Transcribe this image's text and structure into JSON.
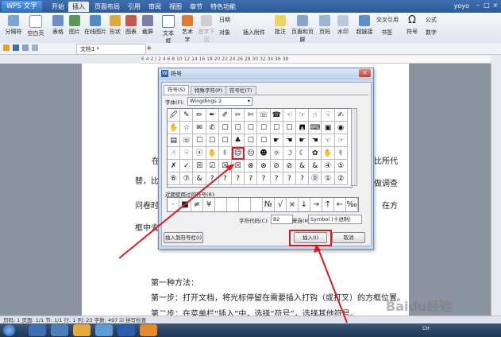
{
  "app": {
    "wps_button": "WPS 文字",
    "user": "yoyo"
  },
  "menu_tabs": [
    "开始",
    "插入",
    "页面布局",
    "引用",
    "审阅",
    "视图",
    "章节",
    "特色功能"
  ],
  "active_tab": "插入",
  "ribbon": {
    "page_break": "分隔符",
    "blank_page": "空白页",
    "table": "表格",
    "picture": "图片",
    "online_picture": "在线图片",
    "shapes": "形状",
    "chart": "图表",
    "screenshot": "截屏",
    "textbox": "文本框",
    "wordart": "艺术字",
    "down_drop": "首字下沉",
    "date": "日期",
    "object": "对象",
    "insert_attachment": "插入附件",
    "comment": "批注",
    "header_footer": "页眉和页脚",
    "page_number": "页码",
    "watermark": "水印",
    "hyperlink": "超链接",
    "bookmark": "书签",
    "cross_ref": "交叉引用",
    "formula": "公式",
    "symbol": "符号",
    "number": "数字"
  },
  "document_tab": "文档1 *",
  "ruler_text": "6 4 2 | 2 4 6 8 10 12 14 16 18 20 22 24 26 28 30 32 34 36 38",
  "doc_lines": [
    "在",
    "替，比",
    "问卷时",
    "框中去",
    "比所代",
    "做调查",
    "在方",
    "第一种方法：",
    "第一步：打开文档，将光标停留在需要插入打钩（或打叉）的方框位置。",
    "第二步：在菜单栏“插入”中，选择“符号”，选择其他符号。"
  ],
  "dialog": {
    "title": "符号",
    "tabs": [
      "符号(S)",
      "特殊字符(P)",
      "符号栏(T)"
    ],
    "font_label": "字体(F):",
    "font_value": "Wingdings 2",
    "symbols": [
      "🖉",
      "✎",
      "✏",
      "✒",
      "✐",
      "✂",
      "✄",
      "☏",
      "☎",
      "☜",
      "☞",
      "☝",
      "☟",
      "✍",
      "✋",
      "☆",
      "✉",
      "✆",
      "☐",
      "☐",
      "☐",
      "☐",
      "☐",
      "☐",
      "🖪",
      "⌨",
      "▣",
      "◉",
      "▤",
      "☏",
      "☐",
      "☐",
      "☐",
      "♣",
      "☐",
      "☐",
      "☛",
      "☚",
      "☛",
      "☚",
      "☜",
      "☞",
      "☝",
      "☟",
      "ⓐ",
      "✋",
      "✌",
      "☺",
      "☹",
      "☻",
      "☼",
      "☽",
      "☾",
      "✿",
      "✋",
      "✌",
      "✗",
      "✓",
      "☒",
      "☑",
      "☒",
      "☒",
      "⊗",
      "⊗",
      "⊘",
      "⊘",
      "&",
      "&",
      "④",
      "⑤",
      "⑥",
      "⑦",
      "&",
      "?",
      "?",
      "?",
      "?",
      "?",
      "?",
      "?",
      "?",
      "⓪",
      "①",
      "②",
      "③",
      "④",
      "⑤",
      "⑥",
      "⑦",
      "⑧"
    ],
    "recent_label": "近期使用过的符号(R):",
    "recent": [
      "·",
      "■",
      "≠",
      "¥",
      "",
      "",
      "",
      "",
      "№",
      "√",
      "×",
      "↓",
      "→",
      "↑",
      "←",
      "‰"
    ],
    "code_label": "字符代码(C):",
    "code_value": "82",
    "from_label": "来自(M)",
    "from_value": "Symbol (十进制)",
    "insert_to_bar": "插入到符号栏(I)",
    "insert_button": "插入(I)",
    "cancel_button": "取消"
  },
  "status": {
    "text": "页码: 1  页面: 1/1  节: 1/1  行: 1  列: 23  字数: 497  ☑ 拼写检查"
  },
  "taskbar": {
    "clock_time": "",
    "tray_text": "CH"
  },
  "watermark_text": "Baidu经验",
  "colors": {
    "accent_red": "#e01818",
    "title_blue": "#2d5a98"
  }
}
